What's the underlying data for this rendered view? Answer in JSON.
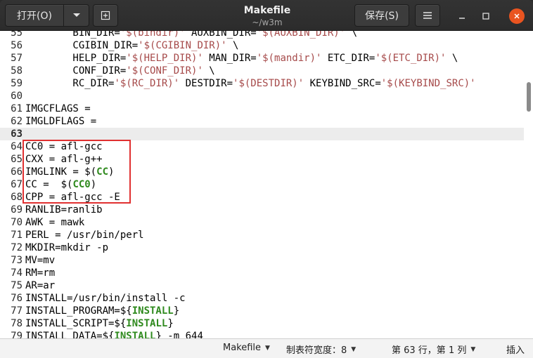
{
  "header": {
    "open_label": "打开(O)",
    "title": "Makefile",
    "subtitle": "~/w3m",
    "save_label": "保存(S)"
  },
  "editor": {
    "current_line": 63,
    "lines": [
      {
        "n": "55",
        "parts": [
          {
            "t": "        BIN_DIR="
          },
          {
            "t": "'$(bindir)'",
            "c": "str"
          },
          {
            "t": " AUXBIN_DIR="
          },
          {
            "t": "'$(AUXBIN_DIR)'",
            "c": "str"
          },
          {
            "t": " \\"
          }
        ]
      },
      {
        "n": "56",
        "parts": [
          {
            "t": "        CGIBIN_DIR="
          },
          {
            "t": "'$(CGIBIN_DIR)'",
            "c": "str"
          },
          {
            "t": " \\"
          }
        ]
      },
      {
        "n": "57",
        "parts": [
          {
            "t": "        HELP_DIR="
          },
          {
            "t": "'$(HELP_DIR)'",
            "c": "str"
          },
          {
            "t": " MAN_DIR="
          },
          {
            "t": "'$(mandir)'",
            "c": "str"
          },
          {
            "t": " ETC_DIR="
          },
          {
            "t": "'$(ETC_DIR)'",
            "c": "str"
          },
          {
            "t": " \\"
          }
        ]
      },
      {
        "n": "58",
        "parts": [
          {
            "t": "        CONF_DIR="
          },
          {
            "t": "'$(CONF_DIR)'",
            "c": "str"
          },
          {
            "t": " \\"
          }
        ]
      },
      {
        "n": "59",
        "parts": [
          {
            "t": "        RC_DIR="
          },
          {
            "t": "'$(RC_DIR)'",
            "c": "str"
          },
          {
            "t": " DESTDIR="
          },
          {
            "t": "'$(DESTDIR)'",
            "c": "str"
          },
          {
            "t": " KEYBIND_SRC="
          },
          {
            "t": "'$(KEYBIND_SRC)'",
            "c": "str"
          }
        ]
      },
      {
        "n": "60",
        "parts": []
      },
      {
        "n": "61",
        "parts": [
          {
            "t": "IMGCFLAGS ="
          }
        ]
      },
      {
        "n": "62",
        "parts": [
          {
            "t": "IMGLDFLAGS ="
          }
        ]
      },
      {
        "n": "63",
        "parts": []
      },
      {
        "n": "64",
        "parts": [
          {
            "t": "CC0 = afl-gcc"
          }
        ]
      },
      {
        "n": "65",
        "parts": [
          {
            "t": "CXX = afl-g++"
          }
        ]
      },
      {
        "n": "66",
        "parts": [
          {
            "t": "IMGLINK = $("
          },
          {
            "t": "CC",
            "c": "kw"
          },
          {
            "t": ")"
          }
        ]
      },
      {
        "n": "67",
        "parts": [
          {
            "t": "CC =  $("
          },
          {
            "t": "CC0",
            "c": "kw"
          },
          {
            "t": ")"
          }
        ]
      },
      {
        "n": "68",
        "parts": [
          {
            "t": "CPP = afl-gcc -E"
          }
        ]
      },
      {
        "n": "69",
        "parts": [
          {
            "t": "RANLIB=ranlib"
          }
        ]
      },
      {
        "n": "70",
        "parts": [
          {
            "t": "AWK = mawk"
          }
        ]
      },
      {
        "n": "71",
        "parts": [
          {
            "t": "PERL = /usr/bin/perl"
          }
        ]
      },
      {
        "n": "72",
        "parts": [
          {
            "t": "MKDIR=mkdir -p"
          }
        ]
      },
      {
        "n": "73",
        "parts": [
          {
            "t": "MV=mv"
          }
        ]
      },
      {
        "n": "74",
        "parts": [
          {
            "t": "RM=rm"
          }
        ]
      },
      {
        "n": "75",
        "parts": [
          {
            "t": "AR=ar"
          }
        ]
      },
      {
        "n": "76",
        "parts": [
          {
            "t": "INSTALL=/usr/bin/install -c"
          }
        ]
      },
      {
        "n": "77",
        "parts": [
          {
            "t": "INSTALL_PROGRAM=${"
          },
          {
            "t": "INSTALL",
            "c": "kw"
          },
          {
            "t": "}"
          }
        ]
      },
      {
        "n": "78",
        "parts": [
          {
            "t": "INSTALL_SCRIPT=${"
          },
          {
            "t": "INSTALL",
            "c": "kw"
          },
          {
            "t": "}"
          }
        ]
      },
      {
        "n": "79",
        "parts": [
          {
            "t": "INSTALL_DATA=${"
          },
          {
            "t": "INSTALL",
            "c": "kw"
          },
          {
            "t": "} -m 644"
          }
        ]
      }
    ]
  },
  "statusbar": {
    "language": "Makefile",
    "tab_width": "制表符宽度：8",
    "position": "第 63 行，第 1 列",
    "mode": "插入"
  },
  "colors": {
    "string": "#a64a4a",
    "keyword": "#2f8a1e",
    "highlight_box": "#e03030",
    "close_button": "#e95420"
  }
}
